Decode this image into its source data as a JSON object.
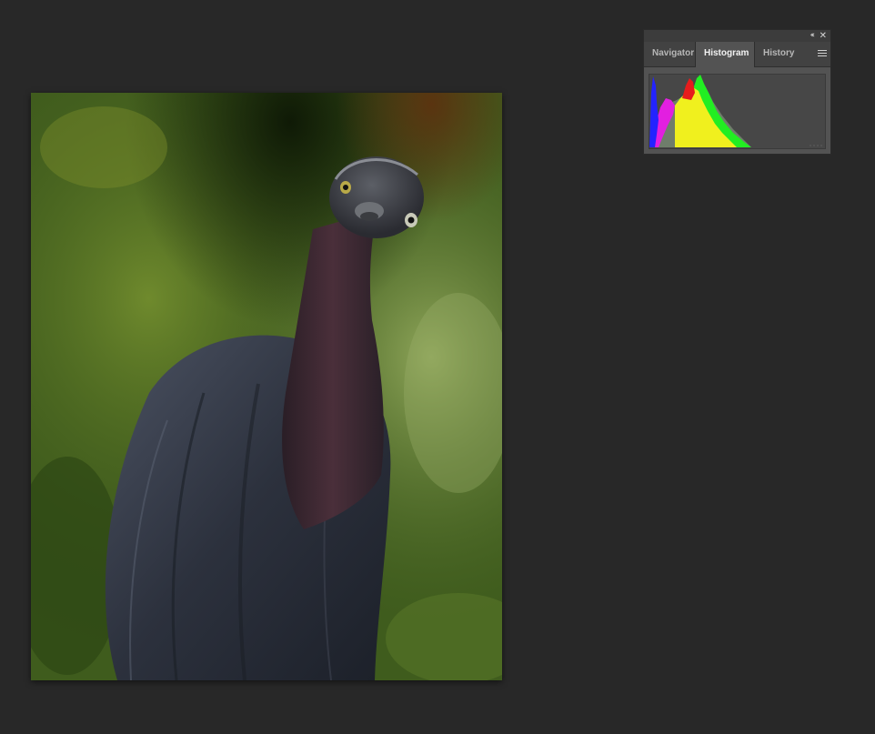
{
  "window": {
    "background": "#282828"
  },
  "document": {
    "image_subject": "little-blue-heron-photo"
  },
  "panel": {
    "tabs": [
      {
        "label": "Navigator",
        "active": false
      },
      {
        "label": "Histogram",
        "active": true
      },
      {
        "label": "History",
        "active": false
      }
    ],
    "collapse_icon": "double-chevron-left-icon",
    "close_icon": "close-icon",
    "menu_icon": "hamburger-menu-icon"
  },
  "histogram": {
    "channel_colors": {
      "blue": "#2323ff",
      "magenta": "#e21fe0",
      "red": "#e61c1c",
      "yellow": "#f0f01e",
      "green": "#22ee22",
      "gray": "#6f7d6b"
    }
  }
}
